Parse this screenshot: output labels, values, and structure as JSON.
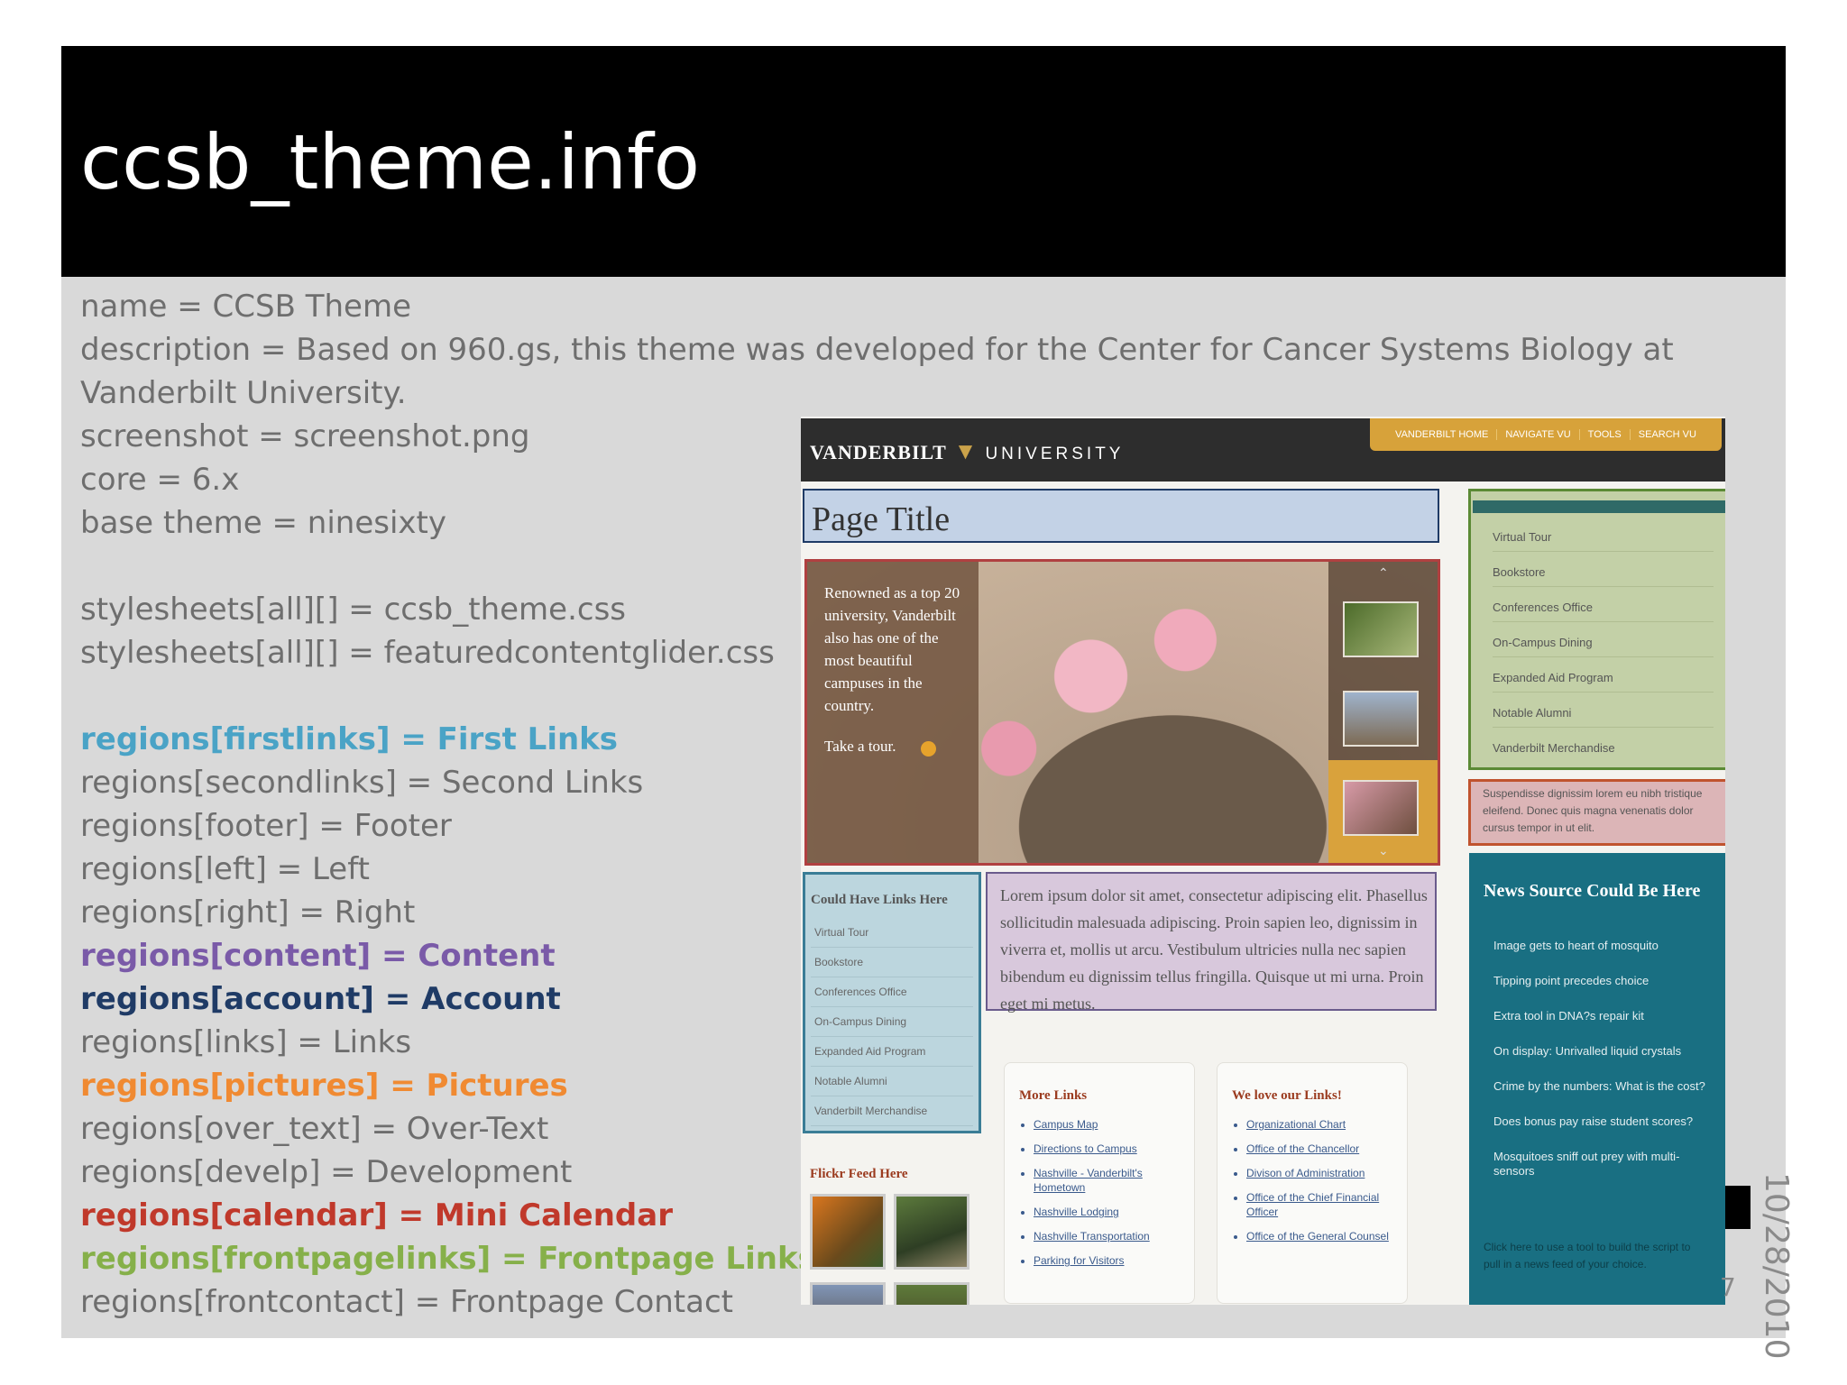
{
  "slide": {
    "title": "ccsb_theme.info",
    "date": "10/28/2010",
    "page_number": "7",
    "lines": [
      "name = CCSB Theme",
      "description = Based on 960.gs, this theme was developed for the Center for Cancer Systems Biology at Vanderbilt University.",
      "screenshot = screenshot.png",
      "core = 6.x",
      "base theme = ninesixty",
      "",
      "stylesheets[all][] = ccsb_theme.css",
      "stylesheets[all][] = featuredcontentglider.css",
      "",
      "regions[firstlinks] = First Links",
      "regions[secondlinks] = Second Links",
      "regions[footer] = Footer",
      "regions[left] = Left",
      "regions[right] = Right",
      "regions[content] = Content",
      "regions[account] = Account",
      "regions[links] = Links",
      "regions[pictures] = Pictures",
      "regions[over_text] = Over-Text",
      "regions[develp] = Development",
      "regions[calendar] = Mini Calendar",
      "regions[frontpagelinks] = Frontpage Links",
      "regions[frontcontact] = Frontpage Contact"
    ],
    "highlight_colors": {
      "firstlinks": "#4aa3c6",
      "content": "#7a5aa8",
      "account": "#1f3b66",
      "pictures": "#f08a32",
      "calendar": "#c0392b",
      "frontpagelinks": "#86b04a",
      "default_text": "#6e6e6e"
    }
  },
  "site": {
    "logo_left": "VANDERBILT",
    "logo_right": "UNIVERSITY",
    "logo_icon": "oak-leaf-v-icon",
    "top_nav": [
      "VANDERBILT HOME",
      "NAVIGATE VU",
      "TOOLS",
      "SEARCH VU"
    ],
    "page_title": "Page Title",
    "feature_text": "Renowned as a top 20 university, Vanderbilt also has one of the most beautiful campuses in the country.",
    "tour_link": "Take a tour.",
    "left_links": {
      "heading": "Could Have Links Here",
      "items": [
        "Virtual Tour",
        "Bookstore",
        "Conferences Office",
        "On-Campus Dining",
        "Expanded Aid Program",
        "Notable Alumni",
        "Vanderbilt Merchandise"
      ]
    },
    "content_text": "Lorem ipsum dolor sit amet, consectetur adipiscing elit. Phasellus sollicitudin malesuada adipiscing. Proin sapien leo, dignissim in viverra et, mollis ut arcu. Vestibulum ultricies nulla nec sapien bibendum eu dignissim tellus fringilla. Quisque ut mi urna. Proin eget mi metus.",
    "more_links": {
      "heading": "More Links",
      "items": [
        "Campus Map",
        "Directions to Campus",
        "Nashville - Vanderbilt's Hometown",
        "Nashville Lodging",
        "Nashville Transportation",
        "Parking for Visitors"
      ]
    },
    "love_links": {
      "heading": "We love our Links!",
      "items": [
        "Organizational Chart",
        "Office of the Chancellor",
        "Divison of Administration",
        "Office of the Chief Financial Officer",
        "Office of the General Counsel"
      ]
    },
    "flickr_heading": "Flickr Feed Here",
    "right_nav": [
      "Virtual Tour",
      "Bookstore",
      "Conferences Office",
      "On-Campus Dining",
      "Expanded Aid Program",
      "Notable Alumni",
      "Vanderbilt Merchandise"
    ],
    "calendar_text": "Suspendisse dignissim lorem eu nibh tristique eleifend. Donec quis magna venenatis dolor cursus tempor in ut elit.",
    "news": {
      "heading": "News Source Could Be Here",
      "items": [
        "Image gets to heart of mosquito",
        "Tipping point precedes choice",
        "Extra tool in DNA?s repair kit",
        "On display: Unrivalled liquid crystals",
        "Crime by the numbers: What is the cost?",
        "Does bonus pay raise student scores?",
        "Mosquitoes sniff out prey with multi-sensors"
      ],
      "footer": "Click here to use a tool to build the script to pull in a news feed of your choice."
    }
  }
}
